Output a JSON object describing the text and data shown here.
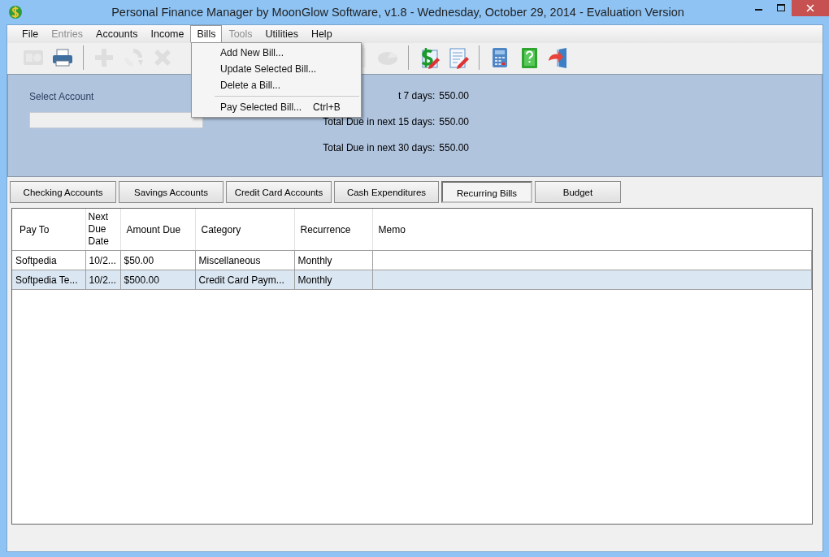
{
  "window": {
    "title": "Personal Finance Manager by MoonGlow Software, v1.8  -  Wednesday, October 29, 2014  -  Evaluation Version",
    "controls": [
      {
        "kind": "minimize"
      },
      {
        "kind": "maximize"
      },
      {
        "kind": "close"
      }
    ]
  },
  "menu_bar": [
    {
      "label": "File",
      "disabled": false,
      "selected": false
    },
    {
      "label": "Entries",
      "disabled": true,
      "selected": false
    },
    {
      "label": "Accounts",
      "disabled": false,
      "selected": false
    },
    {
      "label": "Income",
      "disabled": false,
      "selected": false
    },
    {
      "label": "Bills",
      "disabled": false,
      "selected": true
    },
    {
      "label": "Tools",
      "disabled": true,
      "selected": false
    },
    {
      "label": "Utilities",
      "disabled": false,
      "selected": false
    },
    {
      "label": "Help",
      "disabled": false,
      "selected": false
    }
  ],
  "bills_menu": [
    {
      "kind": "item",
      "label": "Add New Bill..."
    },
    {
      "kind": "item",
      "label": "Update Selected Bill..."
    },
    {
      "kind": "item",
      "label": "Delete a Bill..."
    },
    {
      "kind": "separator"
    },
    {
      "kind": "item",
      "label": "Pay Selected Bill...",
      "shortcut": "Ctrl+B"
    }
  ],
  "toolbar": [
    {
      "kind": "card",
      "disabled": true
    },
    {
      "kind": "printer",
      "disabled": false
    },
    {
      "kind": "separator"
    },
    {
      "kind": "plus",
      "disabled": true
    },
    {
      "kind": "spinner",
      "disabled": true
    },
    {
      "kind": "cross",
      "disabled": true
    },
    {
      "kind": "gap"
    },
    {
      "kind": "document",
      "disabled": true
    },
    {
      "kind": "pie",
      "disabled": true
    },
    {
      "kind": "separator"
    },
    {
      "kind": "dollar-edit",
      "disabled": false
    },
    {
      "kind": "doc-edit",
      "disabled": false
    },
    {
      "kind": "separator"
    },
    {
      "kind": "calculator",
      "disabled": false
    },
    {
      "kind": "help-book",
      "disabled": false
    },
    {
      "kind": "exit-door",
      "disabled": false
    }
  ],
  "account_panel": {
    "select_label": "Select Account",
    "totals": [
      {
        "label": "t 7 days:",
        "value": "550.00"
      },
      {
        "label": "Total Due in next 15 days:",
        "value": "550.00"
      },
      {
        "label": "Total Due in next 30 days:",
        "value": "550.00"
      }
    ]
  },
  "tabs": [
    {
      "label": "Checking Accounts",
      "selected": false
    },
    {
      "label": "Savings Accounts",
      "selected": false
    },
    {
      "label": "Credit Card Accounts",
      "selected": false
    },
    {
      "label": "Cash Expenditures",
      "selected": false
    },
    {
      "label": "Recurring Bills",
      "selected": true
    },
    {
      "label": "Budget",
      "selected": false
    }
  ],
  "table": {
    "columns": [
      "Pay To",
      "Next Due Date",
      "Amount Due",
      "Category",
      "Recurrence",
      "Memo"
    ],
    "rows": [
      {
        "cells": [
          "Softpedia",
          "10/2...",
          "$50.00",
          "Miscellaneous",
          "Monthly",
          ""
        ],
        "selected": false
      },
      {
        "cells": [
          "Softpedia Te...",
          "10/2...",
          "$500.00",
          "Credit Card Paym...",
          "Monthly",
          ""
        ],
        "selected": true
      }
    ]
  }
}
